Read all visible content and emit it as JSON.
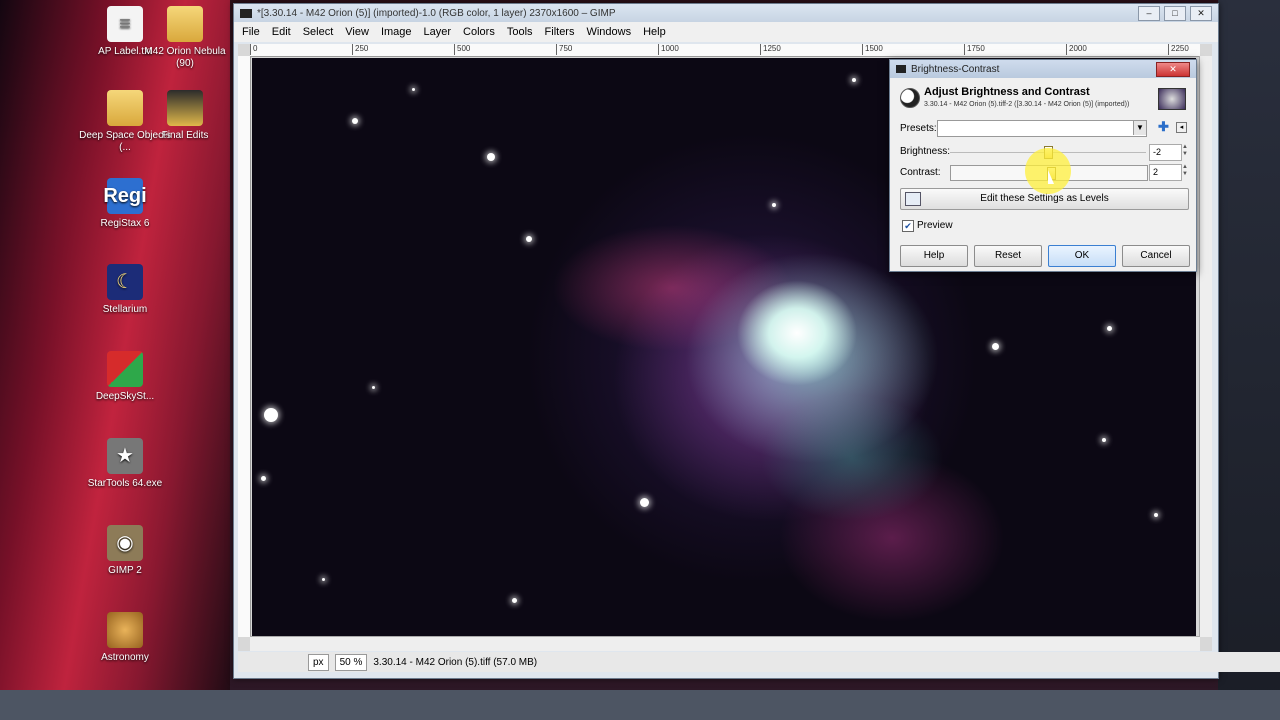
{
  "desktop": {
    "icons": [
      {
        "label": "AP Label.txt",
        "icon": "text-file-icon"
      },
      {
        "label": "M42 Orion Nebula (90)",
        "icon": "folder-icon"
      },
      {
        "label": "Deep Space Objects (...",
        "icon": "folder-icon"
      },
      {
        "label": "Final Edits",
        "icon": "folder-icon"
      },
      {
        "label": "RegiStax 6",
        "icon": "registax-icon"
      },
      {
        "label": "Stellarium",
        "icon": "stellarium-icon"
      },
      {
        "label": "DeepSkySt...",
        "icon": "deepskystacker-icon"
      },
      {
        "label": "StarTools 64.exe",
        "icon": "startools-icon"
      },
      {
        "label": "GIMP 2",
        "icon": "gimp-icon"
      },
      {
        "label": "Astronomy",
        "icon": "saturn-icon"
      }
    ]
  },
  "gimp": {
    "title": "*[3.30.14 - M42 Orion (5)] (imported)-1.0 (RGB color, 1 layer) 2370x1600 – GIMP",
    "window_buttons": {
      "minimize": "–",
      "maximize": "□",
      "close": "✕"
    },
    "menu": [
      "File",
      "Edit",
      "Select",
      "View",
      "Image",
      "Layer",
      "Colors",
      "Tools",
      "Filters",
      "Windows",
      "Help"
    ],
    "ruler_ticks": [
      "0",
      "250",
      "500",
      "750",
      "1000",
      "1250",
      "1500",
      "1750",
      "2000",
      "2250"
    ],
    "status": {
      "unit": "px",
      "zoom": "50 %",
      "info": "3.30.14 - M42 Orion (5).tiff (57.0 MB)"
    }
  },
  "dialog": {
    "title": "Brightness-Contrast",
    "heading": "Adjust Brightness and Contrast",
    "subheading": "3.30.14 - M42 Orion (5).tiff-2 ([3.30.14 - M42 Orion (5)] (imported))",
    "presets_label": "Presets:",
    "presets_value": "",
    "brightness_label": "Brightness:",
    "brightness_value": "-2",
    "contrast_label": "Contrast:",
    "contrast_value": "2",
    "levels_button": "Edit these Settings as Levels",
    "preview_label": "Preview",
    "preview_checked": true,
    "buttons": {
      "help": "Help",
      "reset": "Reset",
      "ok": "OK",
      "cancel": "Cancel"
    }
  },
  "colors": {
    "accent": "#3b7fd1",
    "cursor_highlight": "#fff03c"
  }
}
